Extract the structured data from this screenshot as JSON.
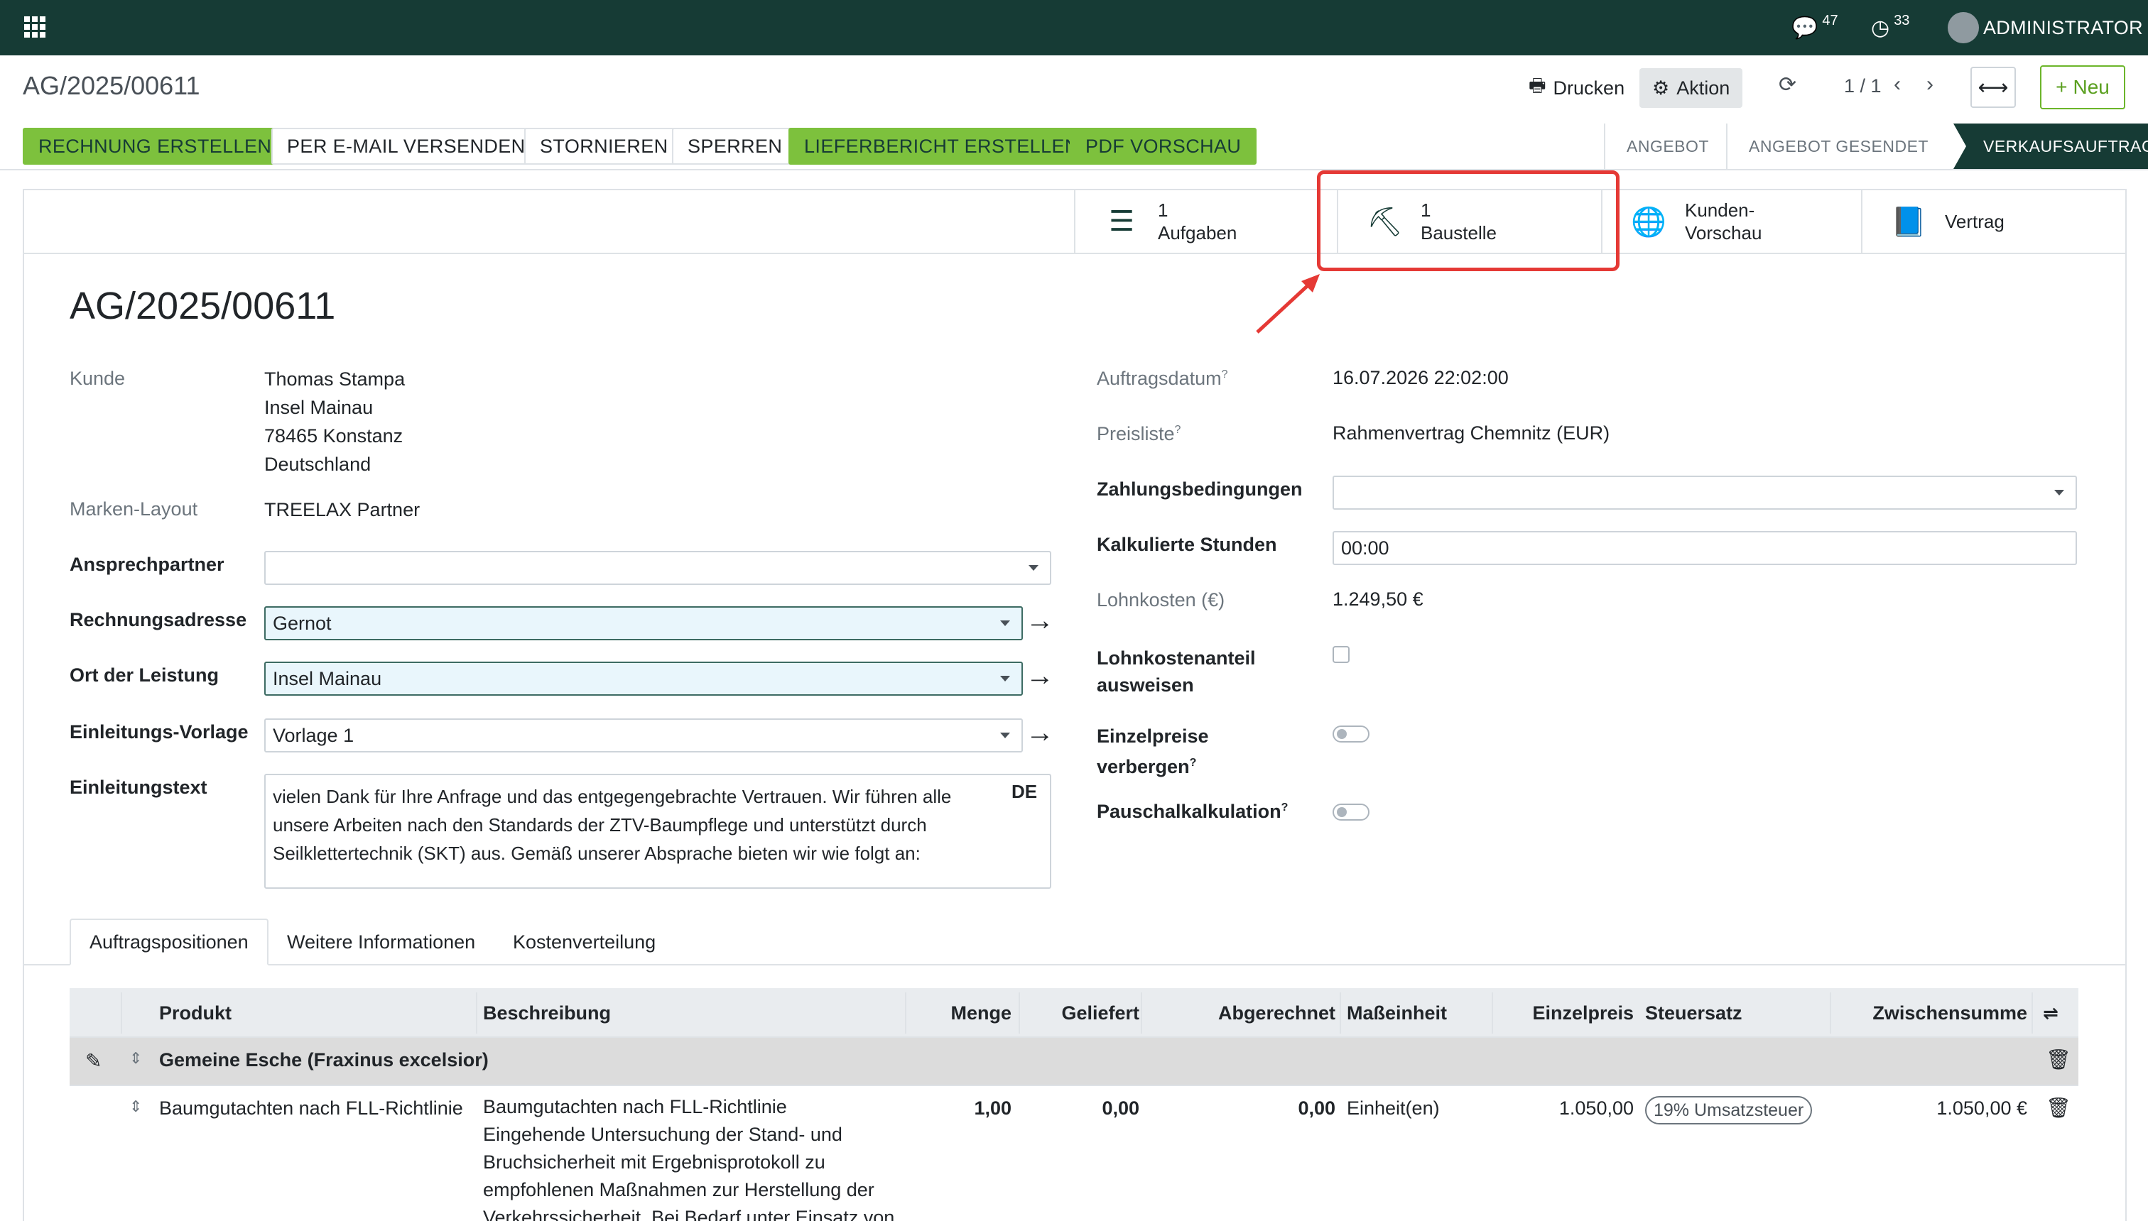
{
  "topbar": {
    "messages_count": "47",
    "activities_count": "33",
    "user_name": "ADMINISTRATOR"
  },
  "control_panel": {
    "breadcrumb": "AG/2025/00611",
    "print_label": "Drucken",
    "action_label": "Aktion",
    "pager": "1 / 1",
    "new_label": "Neu"
  },
  "header_buttons": {
    "invoice": "RECHNUNG ERSTELLEN",
    "email": "PER E-MAIL VERSENDEN",
    "cancel": "STORNIEREN",
    "lock": "SPERREN",
    "delivery": "LIEFERBERICHT ERSTELLEN",
    "pdf": "PDF VORSCHAU"
  },
  "status_stages": [
    "ANGEBOT",
    "ANGEBOT GESENDET",
    "VERKAUFSAUFTRAG"
  ],
  "smart_buttons": {
    "tasks_count": "1",
    "tasks_label": "Aufgaben",
    "site_count": "1",
    "site_label": "Baustelle",
    "preview_line1": "Kunden-",
    "preview_line2": "Vorschau",
    "contract_label": "Vertrag"
  },
  "form": {
    "title": "AG/2025/00611",
    "customer_label": "Kunde",
    "customer_lines": [
      "Thomas Stampa",
      "Insel Mainau",
      "78465 Konstanz",
      "Deutschland"
    ],
    "brand_layout_label": "Marken-Layout",
    "brand_layout_value": "TREELAX Partner",
    "contact_label": "Ansprechpartner",
    "contact_value": "",
    "invoice_address_label": "Rechnungsadresse",
    "invoice_address_value": "Gernot",
    "service_location_label": "Ort der Leistung",
    "service_location_value": "Insel Mainau",
    "intro_template_label": "Einleitungs-Vorlage",
    "intro_template_value": "Vorlage 1",
    "intro_text_label": "Einleitungstext",
    "intro_text_value": "vielen Dank für Ihre Anfrage und das entgegengebrachte Vertrauen. Wir führen alle unsere Arbeiten nach den Standards der ZTV-Baumpflege und unterstützt durch Seilklettertechnik (SKT) aus. Gemäß unserer Absprache bieten wir wie folgt an:",
    "intro_text_lang": "DE",
    "order_date_label": "Auftragsdatum",
    "order_date_value": "16.07.2026 22:02:00",
    "pricelist_label": "Preisliste",
    "pricelist_value": "Rahmenvertrag Chemnitz (EUR)",
    "payment_terms_label": "Zahlungsbedingungen",
    "payment_terms_value": "",
    "calc_hours_label": "Kalkulierte Stunden",
    "calc_hours_value": "00:00",
    "labor_cost_label": "Lohnkosten (€)",
    "labor_cost_value": "1.249,50 €",
    "labor_share_label_1": "Lohnkostenanteil",
    "labor_share_label_2": "ausweisen",
    "hide_prices_label_1": "Einzelpreise",
    "hide_prices_label_2": "verbergen",
    "flat_calc_label": "Pauschalkalkulation",
    "help_mark": "?"
  },
  "tabs": [
    "Auftragspositionen",
    "Weitere Informationen",
    "Kostenverteilung"
  ],
  "table": {
    "columns": [
      "Produkt",
      "Beschreibung",
      "Menge",
      "Geliefert",
      "Abgerechnet",
      "Maßeinheit",
      "Einzelpreis",
      "Steuersatz",
      "Zwischensumme"
    ],
    "section_title": "Gemeine Esche (Fraxinus excelsior)",
    "row": {
      "product": "Baumgutachten nach FLL-Richtlinie",
      "description_lines": [
        "Baumgutachten nach FLL-Richtlinie",
        "Eingehende Untersuchung der Stand- und",
        "Bruchsicherheit mit Ergebnisprotokoll zu",
        "empfohlenen Maßnahmen zur Herstellung der",
        "Verkehrssicherheit. Bei Bedarf unter Einsatz von"
      ],
      "quantity": "1,00",
      "delivered": "0,00",
      "invoiced": "0,00",
      "uom": "Einheit(en)",
      "unit_price": "1.050,00",
      "tax": "19% Umsatzsteuer",
      "subtotal": "1.050,00 €"
    }
  },
  "colors": {
    "navbar": "#163b35",
    "primary_button": "#7dc13d",
    "highlight_box": "#e53935"
  }
}
